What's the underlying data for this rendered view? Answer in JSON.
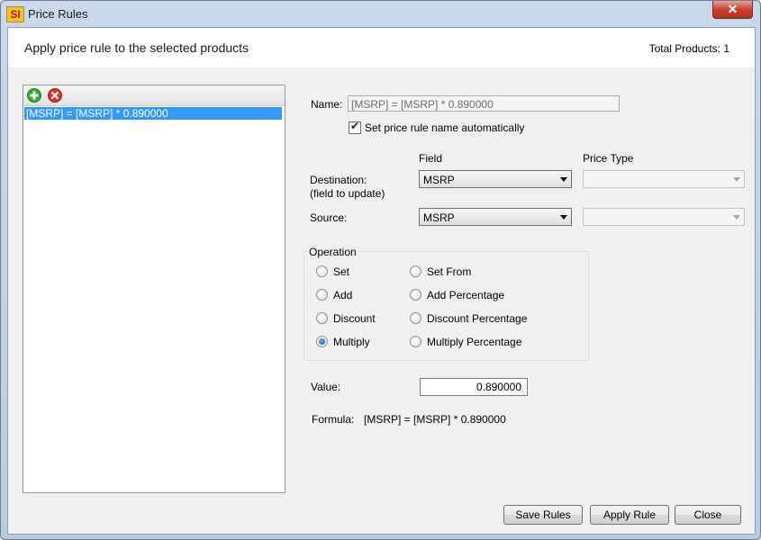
{
  "window": {
    "app_icon_text": "SI",
    "title": "Price Rules",
    "close_symbol": "✕"
  },
  "header": {
    "title": "Apply price rule to the selected products",
    "total_products": "Total Products: 1"
  },
  "rules_list": {
    "toolbar": {
      "add_icon": "plus-circle-icon",
      "delete_icon": "x-circle-icon"
    },
    "items": [
      {
        "label": "[MSRP] = [MSRP] * 0.890000",
        "selected": true
      }
    ]
  },
  "form": {
    "name_label": "Name:",
    "name_value": "[MSRP] = [MSRP] * 0.890000",
    "auto_name_label": "Set price rule name automatically",
    "auto_name_checked": true,
    "field_header": "Field",
    "price_type_header": "Price Type",
    "destination_label": "Destination:",
    "destination_sublabel": "(field to update)",
    "destination_field": "MSRP",
    "destination_price_type": "",
    "source_label": "Source:",
    "source_field": "MSRP",
    "source_price_type": ""
  },
  "operation": {
    "legend": "Operation",
    "options": [
      {
        "label": "Set",
        "selected": false
      },
      {
        "label": "Add",
        "selected": false
      },
      {
        "label": "Discount",
        "selected": false
      },
      {
        "label": "Multiply",
        "selected": true
      },
      {
        "label": "Set From",
        "selected": false
      },
      {
        "label": "Add Percentage",
        "selected": false
      },
      {
        "label": "Discount Percentage",
        "selected": false
      },
      {
        "label": "Multiply Percentage",
        "selected": false
      }
    ]
  },
  "value": {
    "label": "Value:",
    "value": "0.890000"
  },
  "formula": {
    "label": "Formula:",
    "text": "[MSRP] = [MSRP] * 0.890000"
  },
  "buttons": {
    "save": "Save Rules",
    "apply": "Apply Rule",
    "close": "Close"
  },
  "colors": {
    "selection": "#3399ff",
    "close_button": "#c7432f",
    "add_icon": "#3aa53a",
    "delete_icon": "#d9342b"
  }
}
